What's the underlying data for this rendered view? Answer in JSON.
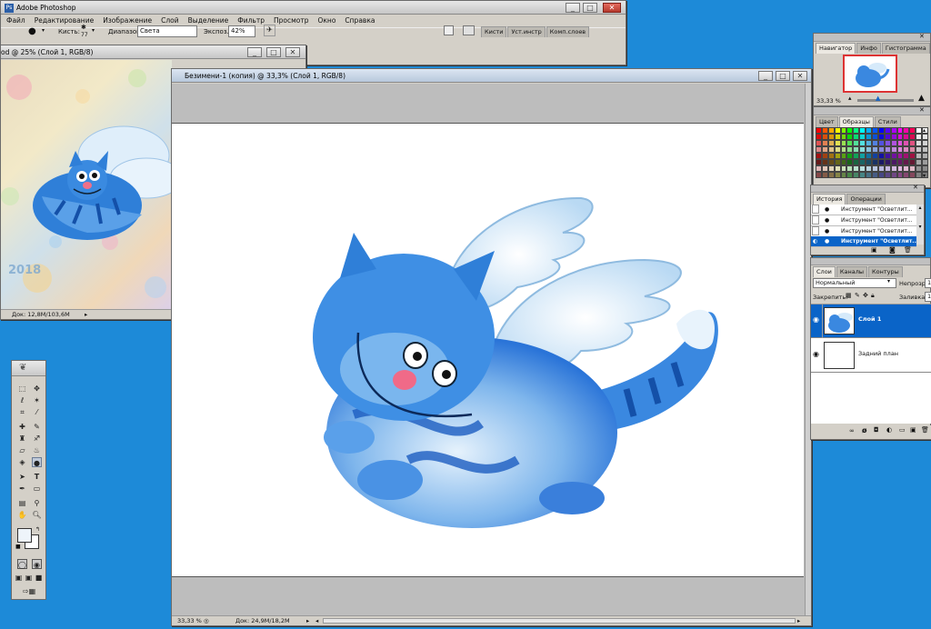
{
  "app_title": "Adobe Photoshop",
  "menu": [
    "Файл",
    "Редактирование",
    "Изображение",
    "Слой",
    "Выделение",
    "Фильтр",
    "Просмотр",
    "Окно",
    "Справка"
  ],
  "options": {
    "brush_label": "Кисть:",
    "brush_size": "77",
    "range_label": "Диапазон:",
    "range_value": "Света",
    "exposure_label": "Экспоз.:",
    "exposure_value": "42%",
    "dock_tabs": [
      "Кисти",
      "Уст.инстр",
      "Комп.слоев"
    ]
  },
  "doc_back": {
    "title": "od @ 25% (Слой 1, RGB/8)",
    "status": "Док: 12,8M/103,6M",
    "art_year": "2018"
  },
  "doc_main": {
    "title": "Безимени-1 (копия) @ 33,3% (Слой 1, RGB/8)",
    "zoom": "33,33 %",
    "status": "Док: 24,9M/18,2M"
  },
  "navigator": {
    "tabs": [
      "Навигатор",
      "Инфо",
      "Гистограмма"
    ],
    "zoom": "33,33 %"
  },
  "swatches": {
    "tabs": [
      "Цвет",
      "Образцы",
      "Стили"
    ]
  },
  "history": {
    "tabs": [
      "История",
      "Операции"
    ],
    "items": [
      "Инструмент \"Осветлит...",
      "Инструмент \"Осветлит...",
      "Инструмент \"Осветлит...",
      "Инструмент \"Осветлит..."
    ]
  },
  "layers": {
    "tabs": [
      "Слои",
      "Каналы",
      "Контуры"
    ],
    "blend_mode": "Нормальный",
    "opacity_label": "Непрозр.:",
    "opacity_value": "10",
    "lock_label": "Закрепить:",
    "fill_label": "Заливка:",
    "fill_value": "10",
    "items": [
      "Слой 1",
      "Задний план"
    ]
  },
  "colors": {
    "desktop": "#1d8ad8",
    "selection": "#0a64c8",
    "cat_blue": "#2a74d8"
  }
}
